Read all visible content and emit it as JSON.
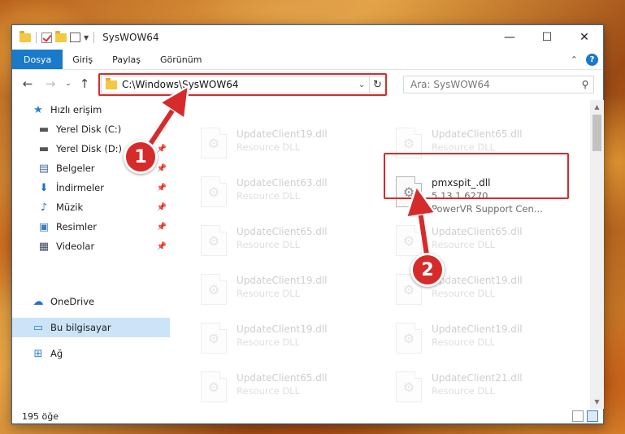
{
  "window": {
    "title": "SysWOW64",
    "minimize_glyph": "—",
    "maximize_glyph": "☐",
    "close_glyph": "✕"
  },
  "ribbon": {
    "tabs": [
      "Dosya",
      "Giriş",
      "Paylaş",
      "Görünüm"
    ],
    "collapse_glyph": "⌃",
    "help_glyph": "?"
  },
  "nav": {
    "back_glyph": "←",
    "forward_glyph": "→",
    "recent_glyph": "⌄",
    "up_glyph": "↑",
    "address": "C:\\Windows\\SysWOW64",
    "address_drop_glyph": "⌄",
    "refresh_glyph": "↻",
    "search_placeholder": "Ara: SysWOW64",
    "search_glyph": "⚲"
  },
  "sidebar": {
    "items": [
      {
        "label": "Hızlı erişim",
        "icon": "star-icon",
        "glyph": "★",
        "color": "#2b7cd3",
        "pinned": false
      },
      {
        "label": "Yerel Disk (C:)",
        "icon": "drive-icon",
        "glyph": "▬",
        "color": "#555555",
        "pinned": true
      },
      {
        "label": "Yerel Disk (D:)",
        "icon": "drive-icon",
        "glyph": "▬",
        "color": "#555555",
        "pinned": true
      },
      {
        "label": "Belgeler",
        "icon": "documents-icon",
        "glyph": "▤",
        "color": "#4a6c9b",
        "pinned": true
      },
      {
        "label": "İndirmeler",
        "icon": "download-icon",
        "glyph": "⬇",
        "color": "#1f6fcf",
        "pinned": true
      },
      {
        "label": "Müzik",
        "icon": "music-icon",
        "glyph": "♪",
        "color": "#1f6fcf",
        "pinned": true
      },
      {
        "label": "Resimler",
        "icon": "pictures-icon",
        "glyph": "▣",
        "color": "#3f7fb8",
        "pinned": true
      },
      {
        "label": "Videolar",
        "icon": "videos-icon",
        "glyph": "▦",
        "color": "#3d4a5c",
        "pinned": true
      },
      {
        "label": "OneDrive",
        "icon": "cloud-icon",
        "glyph": "☁",
        "color": "#1f6fcf",
        "pinned": false
      },
      {
        "label": "Bu bilgisayar",
        "icon": "computer-icon",
        "glyph": "▭",
        "color": "#2b7cd3",
        "pinned": false
      },
      {
        "label": "Ağ",
        "icon": "network-icon",
        "glyph": "⊞",
        "color": "#2b7cd3",
        "pinned": false
      }
    ],
    "pin_glyph": "📌"
  },
  "files": [
    {
      "name": "UpdateClient19.dll",
      "sub1": "Resource DLL",
      "sub2": ""
    },
    {
      "name": "UpdateClient65.dll",
      "sub1": "Resource DLL",
      "sub2": ""
    },
    {
      "name": "UpdateClient63.dll",
      "sub1": "Resource DLL",
      "sub2": ""
    },
    {
      "name": "pmxspit_.dll",
      "sub1": "5.13.1.6270",
      "sub2": "PowerVR Support Cen..."
    },
    {
      "name": "UpdateClient65.dll",
      "sub1": "Resource DLL",
      "sub2": ""
    },
    {
      "name": "UpdateClient65.dll",
      "sub1": "Resource DLL",
      "sub2": ""
    },
    {
      "name": "UpdateClient19.dll",
      "sub1": "Resource DLL",
      "sub2": ""
    },
    {
      "name": "UpdateClient19.dll",
      "sub1": "Resource DLL",
      "sub2": ""
    },
    {
      "name": "UpdateClient19.dll",
      "sub1": "Resource DLL",
      "sub2": ""
    },
    {
      "name": "UpdateClient19.dll",
      "sub1": "Resource DLL",
      "sub2": ""
    },
    {
      "name": "UpdateClient65.dll",
      "sub1": "Resource DLL",
      "sub2": ""
    },
    {
      "name": "UpdateClient21.dll",
      "sub1": "Resource DLL",
      "sub2": ""
    }
  ],
  "file_icon_glyph": "⚙",
  "scroll": {
    "up_glyph": "▲",
    "down_glyph": "▼"
  },
  "status": {
    "item_count": "195 öğe"
  },
  "callouts": [
    "1",
    "2"
  ],
  "colors": {
    "accent": "#1979ca",
    "highlight": "#d62b2b",
    "selected": "#cce4f7"
  }
}
